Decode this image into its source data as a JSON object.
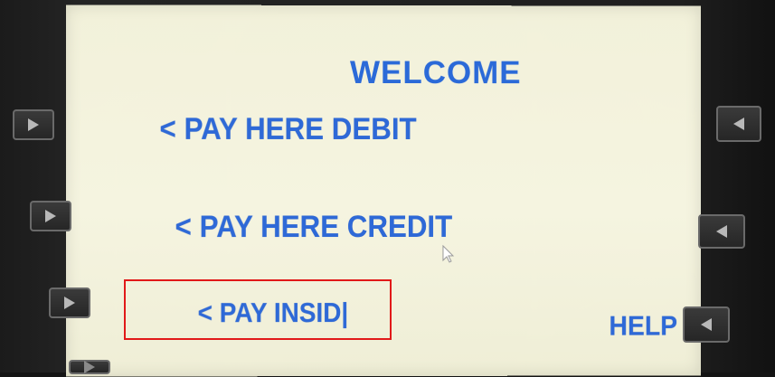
{
  "screen": {
    "title": "WELCOME",
    "options": {
      "pay_here_debit": "< PAY HERE DEBIT",
      "pay_here_credit": "< PAY HERE CREDIT",
      "pay_inside": "< PAY INSID|",
      "help": "HELP >"
    }
  },
  "colors": {
    "screen_bg": "#f4f3de",
    "text_blue": "#2e69d7",
    "highlight_red": "#e11919",
    "bezel": "#1b1b1b"
  },
  "icons": {
    "left_buttons": "play-right-icon",
    "right_buttons": "play-left-icon",
    "cursor": "mouse-pointer-icon"
  }
}
